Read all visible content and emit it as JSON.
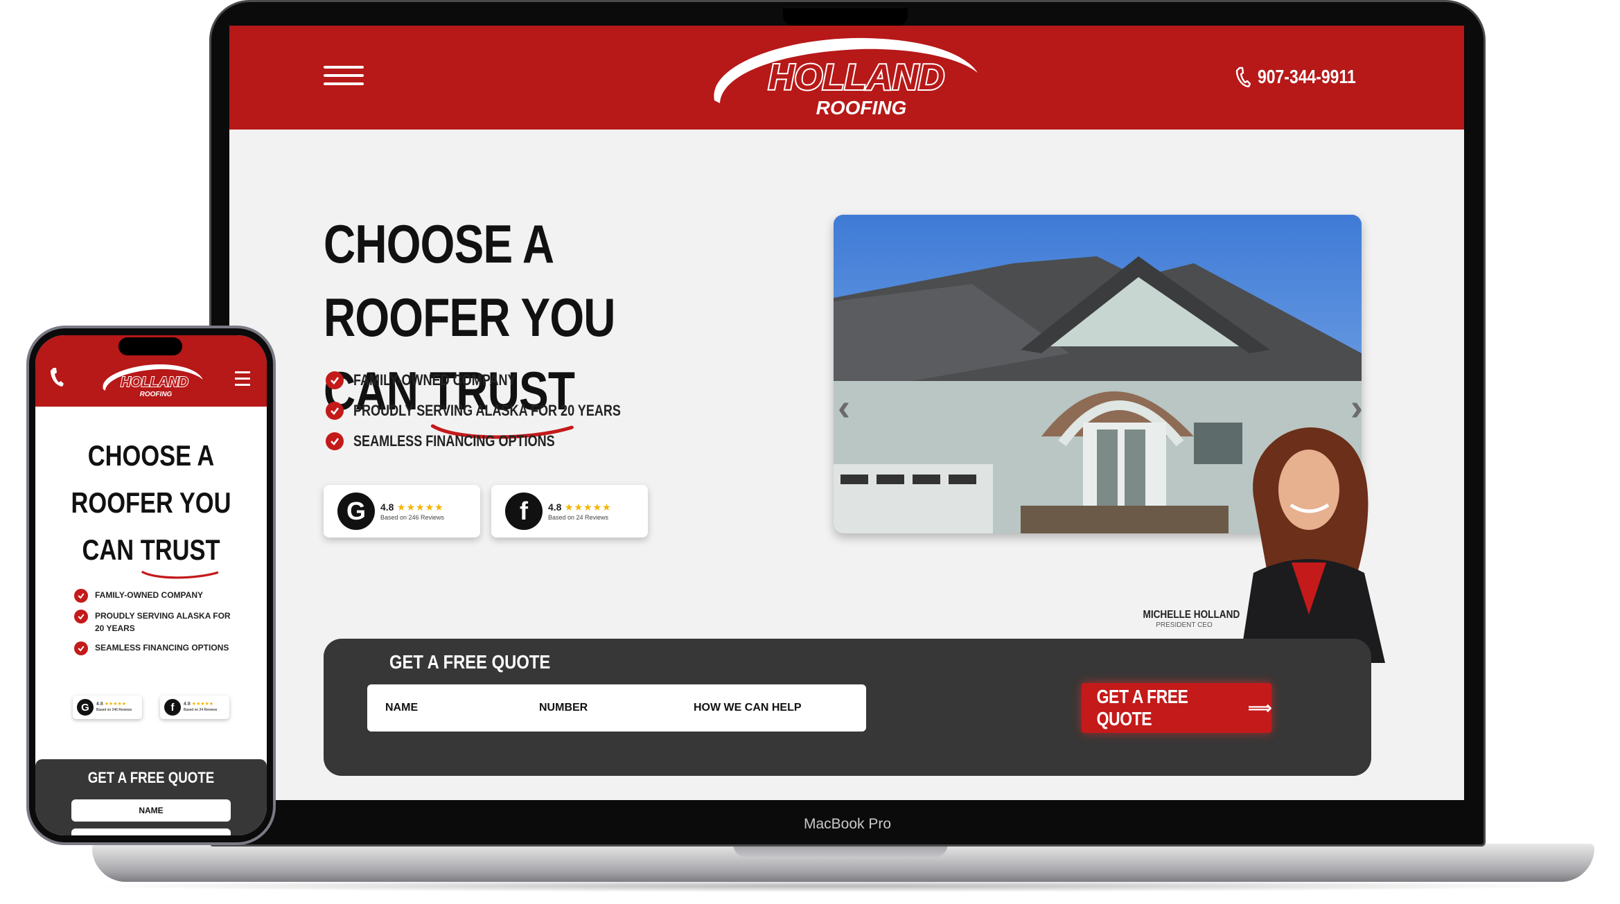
{
  "laptop": {
    "label": "MacBook Pro",
    "header": {
      "logo_line1": "HOLLAND",
      "logo_line2": "ROOFING",
      "phone": "907-344-9911"
    },
    "hero": {
      "title_line1": "CHOOSE A ROOFER YOU",
      "title_line2_a": "CAN",
      "title_line2_b": "TRUST",
      "features": [
        "FAMILY-OWNED COMPANY",
        "PROUDLY SERVING ALASKA FOR 20 YEARS",
        "SEAMLESS FINANCING OPTIONS"
      ]
    },
    "reviews": [
      {
        "icon": "google-icon",
        "glyph": "G",
        "rating": "4.8",
        "stars": "★★★★★",
        "sub": "Based on 246 Reviews"
      },
      {
        "icon": "facebook-icon",
        "glyph": "f",
        "rating": "4.8",
        "stars": "★★★★★",
        "sub": "Based on 24 Reviews"
      }
    ],
    "person": {
      "name": "MICHELLE HOLLAND",
      "role": "PRESIDENT CEO"
    },
    "quote_form": {
      "title": "GET A FREE QUOTE",
      "fields": {
        "name": "NAME",
        "number": "NUMBER",
        "help": "HOW WE CAN HELP"
      },
      "button": "GET A FREE QUOTE",
      "button_arrow": "⟹"
    },
    "colors": {
      "brand_red": "#b71818",
      "form_bg": "#373737",
      "page_bg": "#f2f2f2"
    }
  },
  "phone": {
    "logo_line1": "HOLLAND",
    "logo_line2": "ROOFING",
    "title_line1": "CHOOSE A",
    "title_line2": "ROOFER YOU",
    "title_line3_a": "CAN",
    "title_line3_b": "TRUST",
    "features": [
      "FAMILY-OWNED COMPANY",
      "PROUDLY SERVING ALASKA FOR 20 YEARS",
      "SEAMLESS FINANCING OPTIONS"
    ],
    "reviews": [
      {
        "glyph": "G",
        "rating": "4.8",
        "stars": "★★★★★",
        "sub": "Based on 246 Reviews"
      },
      {
        "glyph": "f",
        "rating": "4.8",
        "stars": "★★★★★",
        "sub": "Based on 24 Reviews"
      }
    ],
    "quote_title": "GET A FREE QUOTE",
    "quote_name": "NAME"
  }
}
